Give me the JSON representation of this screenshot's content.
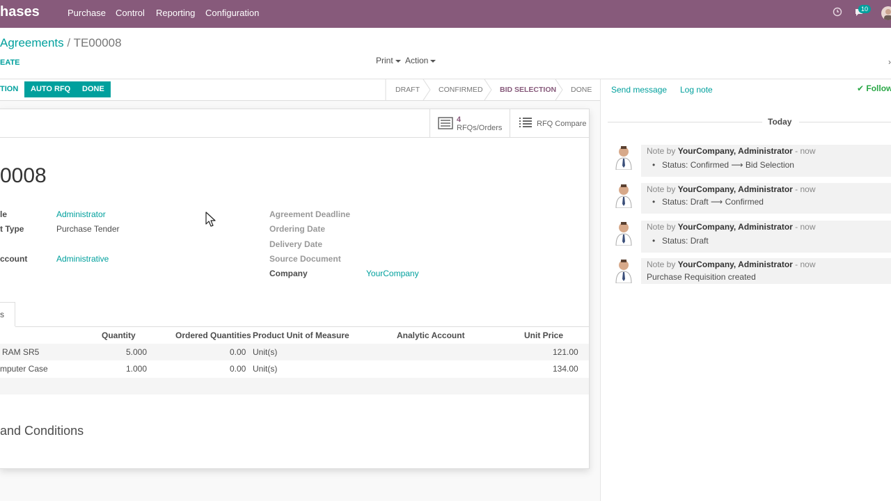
{
  "navbar": {
    "app_title": "hases",
    "menu": [
      "Purchase",
      "Control",
      "Reporting",
      "Configuration"
    ],
    "chat_badge": "10"
  },
  "control_panel": {
    "breadcrumb_parent": "Agreements",
    "breadcrumb_sep": "/",
    "breadcrumb_current": "TE00008",
    "create_label": "EATE",
    "print_label": "Print",
    "action_label": "Action"
  },
  "statusbar": {
    "buttons": [
      "TION",
      "AUTO RFQ",
      "DONE"
    ],
    "stages": [
      "DRAFT",
      "CONFIRMED",
      "BID SELECTION",
      "DONE"
    ],
    "active_stage": "BID SELECTION"
  },
  "smart_buttons": {
    "rfq_count": "4",
    "rfq_label": "RFQs/Orders",
    "compare_label": "RFQ Compare"
  },
  "record": {
    "title": "0008",
    "left_fields": [
      {
        "label": "le",
        "value": "Administrator"
      },
      {
        "label": "t Type",
        "value": "Purchase Tender"
      },
      {
        "label": "ccount",
        "value": "Administrative"
      }
    ],
    "right_fields": [
      {
        "label": "Agreement Deadline",
        "value": ""
      },
      {
        "label": "Ordering Date",
        "value": ""
      },
      {
        "label": "Delivery Date",
        "value": ""
      },
      {
        "label": "Source Document",
        "value": ""
      },
      {
        "label": "Company",
        "value": "YourCompany"
      }
    ]
  },
  "tab_label": "s",
  "lines": {
    "columns": [
      "Quantity",
      "Ordered Quantities",
      "Product Unit of Measure",
      "Analytic Account",
      "Unit Price"
    ],
    "rows": [
      {
        "product": "RAM SR5",
        "quantity": "5.000",
        "ordered": "0.00",
        "uom": "Unit(s)",
        "analytic": "",
        "price": "121.00"
      },
      {
        "product": "mputer Case",
        "quantity": "1.000",
        "ordered": "0.00",
        "uom": "Unit(s)",
        "analytic": "",
        "price": "134.00"
      }
    ]
  },
  "terms_title": "and Conditions",
  "chatter": {
    "send_message": "Send message",
    "log_note": "Log note",
    "following": "Followi",
    "day": "Today",
    "messages": [
      {
        "prefix": "Note by",
        "author": "YourCompany, Administrator",
        "time": "- now",
        "text": "Status: Confirmed ⟶ Bid Selection",
        "bullet": true
      },
      {
        "prefix": "Note by",
        "author": "YourCompany, Administrator",
        "time": "- now",
        "text": "Status: Draft ⟶ Confirmed",
        "bullet": true
      },
      {
        "prefix": "Note by",
        "author": "YourCompany, Administrator",
        "time": "- now",
        "text": "Status: Draft",
        "bullet": true
      },
      {
        "prefix": "Note by",
        "author": "YourCompany, Administrator",
        "time": "- now",
        "text": "Purchase Requisition created",
        "bullet": false
      }
    ]
  },
  "colors": {
    "brand": "#875a7b",
    "accent": "#00a09d"
  }
}
